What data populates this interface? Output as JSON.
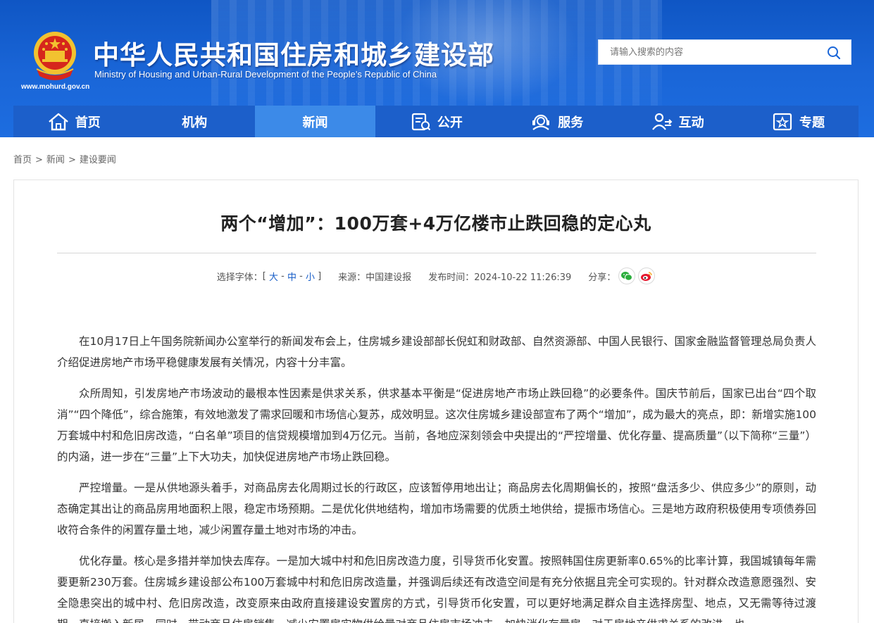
{
  "header": {
    "title_cn": "中华人民共和国住房和城乡建设部",
    "title_en": "Ministry of Housing and Urban-Rural Development of the People’s Republic of China",
    "url": "www.mohurd.gov.cn",
    "search_placeholder": "请输入搜索的内容"
  },
  "nav": {
    "items": [
      {
        "label": "首页",
        "icon": "home-icon"
      },
      {
        "label": "机构",
        "icon": ""
      },
      {
        "label": "新闻",
        "icon": "",
        "active": true
      },
      {
        "label": "公开",
        "icon": "document-icon"
      },
      {
        "label": "服务",
        "icon": "service-icon"
      },
      {
        "label": "互动",
        "icon": "interaction-icon"
      },
      {
        "label": "专题",
        "icon": "star-box-icon"
      }
    ]
  },
  "breadcrumb": {
    "items": [
      "首页",
      "新闻",
      "建设要闻"
    ],
    "separator": ">"
  },
  "article": {
    "title": "两个“增加”：100万套+4万亿楼市止跌回稳的定心丸",
    "font_label": "选择字体：",
    "font_open": "[",
    "font_large": "大",
    "font_medium": "中",
    "font_small": "小",
    "font_dash": "-",
    "font_close": "]",
    "source": "来源：中国建设报",
    "published": "发布时间：2024-10-22 11:26:39",
    "share_label": "分享：",
    "paragraphs": [
      "在10月17日上午国务院新闻办公室举行的新闻发布会上，住房城乡建设部部长倪虹和财政部、自然资源部、中国人民银行、国家金融监督管理总局负责人介绍促进房地产市场平稳健康发展有关情况，内容十分丰富。",
      "众所周知，引发房地产市场波动的最根本性因素是供求关系，供求基本平衡是“促进房地产市场止跌回稳”的必要条件。国庆节前后，国家已出台“四个取消”“四个降低”，综合施策，有效地激发了需求回暖和市场信心复苏，成效明显。这次住房城乡建设部宣布了两个“增加”，成为最大的亮点，即：新增实施100万套城中村和危旧房改造，“白名单”项目的信贷规模增加到4万亿元。当前，各地应深刻领会中央提出的“严控增量、优化存量、提高质量”（以下简称“三量”）的内涵，进一步在“三量”上下大功夫，加快促进房地产市场止跌回稳。",
      "严控增量。一是从供地源头着手，对商品房去化周期过长的行政区，应该暂停用地出让；商品房去化周期偏长的，按照“盘活多少、供应多少”的原则，动态确定其出让的商品房用地面积上限，稳定市场预期。二是优化供地结构，增加市场需要的优质土地供给，提振市场信心。三是地方政府积极使用专项债券回收符合条件的闲置存量土地，减少闲置存量土地对市场的冲击。",
      "优化存量。核心是多措并举加快去库存。一是加大城中村和危旧房改造力度，引导货币化安置。按照韩国住房更新率0.65%的比率计算，我国城镇每年需要更新230万套。住房城乡建设部公布100万套城中村和危旧房改造量，并强调后续还有改造空间是有充分依据且完全可实现的。针对群众改造意愿强烈、安全隐患突出的城中村、危旧房改造，改变原来由政府直接建设安置房的方式，引导货币化安置，可以更好地满足群众自主选择房型、地点，又无需等待过渡期，直接搬入新居。同时，带动商品住房销售，减少安置房实物供给量对商品住房市场冲击，加快消化存量房，对于房地产供求关系的改进，也"
    ]
  },
  "colors": {
    "header_blue": "#1a66d8",
    "nav_blue": "#1c5fca",
    "nav_active": "#3c8ae8",
    "link_blue": "#1a5fc8"
  }
}
